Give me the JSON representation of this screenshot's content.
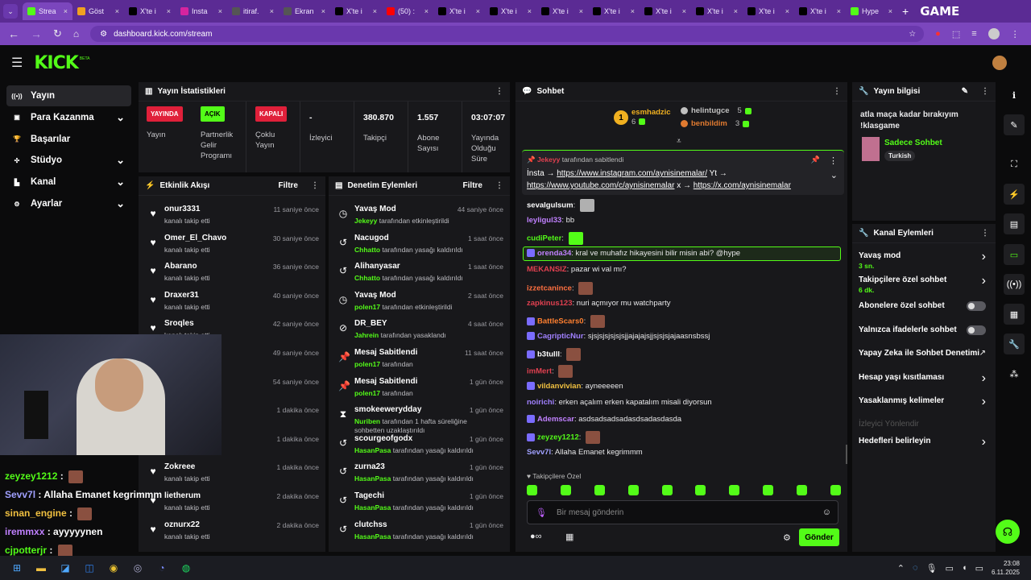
{
  "browser": {
    "tabs": [
      {
        "label": "Strea",
        "color": "#53fc18",
        "active": true
      },
      {
        "label": "Göst",
        "color": "#f0a020"
      },
      {
        "label": "X'te i",
        "color": "#000000"
      },
      {
        "label": "Insta",
        "color": "#d6249f"
      },
      {
        "label": "itiraf.",
        "color": "#555555"
      },
      {
        "label": "Ekran",
        "color": "#555555"
      },
      {
        "label": "X'te i",
        "color": "#000000"
      },
      {
        "label": "(50) :",
        "color": "#ff0000"
      },
      {
        "label": "X'te i",
        "color": "#000000"
      },
      {
        "label": "X'te i",
        "color": "#000000"
      },
      {
        "label": "X'te i",
        "color": "#000000"
      },
      {
        "label": "X'te i",
        "color": "#000000"
      },
      {
        "label": "X'te i",
        "color": "#000000"
      },
      {
        "label": "X'te i",
        "color": "#000000"
      },
      {
        "label": "X'te i",
        "color": "#000000"
      },
      {
        "label": "X'te i",
        "color": "#000000"
      },
      {
        "label": "Hype",
        "color": "#53fc18"
      }
    ],
    "url": "dashboard.kick.com/stream",
    "watermark": "GAME"
  },
  "kick": {
    "logo": "KICK",
    "beta": "BETA"
  },
  "sidebar": {
    "items": [
      {
        "label": "Yayın",
        "icon": "stream-icon",
        "active": true
      },
      {
        "label": "Para Kazanma",
        "icon": "money-icon",
        "chevron": true
      },
      {
        "label": "Başarılar",
        "icon": "trophy-icon"
      },
      {
        "label": "Stüdyo",
        "icon": "studio-icon",
        "chevron": true
      },
      {
        "label": "Kanal",
        "icon": "channel-icon",
        "chevron": true
      },
      {
        "label": "Ayarlar",
        "icon": "gear-icon",
        "chevron": true
      }
    ]
  },
  "stats": {
    "title": "Yayın İstatistikleri",
    "live_badge": "YAYINDA",
    "live_label": "Yayın",
    "partner_badge": "AÇIK",
    "partner_label": "Partnerlik Gelir Programı",
    "multi_badge": "KAPALI",
    "multi_label": "Çoklu Yayın",
    "viewers_val": "-",
    "viewers_label": "İzleyici",
    "followers_val": "380.870",
    "followers_label": "Takipçi",
    "subs_val": "1.557",
    "subs_label": "Abone Sayısı",
    "uptime_val": "03:07:07",
    "uptime_label": "Yayında Olduğu Süre"
  },
  "activity": {
    "title": "Etkinlik Akışı",
    "filter": "Filtre",
    "items": [
      {
        "name": "onur3331",
        "desc": "kanalı takip etti",
        "time": "11 saniye önce"
      },
      {
        "name": "Omer_El_Chavo",
        "desc": "kanalı takip etti",
        "time": "30 saniye önce"
      },
      {
        "name": "Abarano",
        "desc": "kanalı takip etti",
        "time": "36 saniye önce"
      },
      {
        "name": "Draxer31",
        "desc": "kanalı takip etti",
        "time": "40 saniye önce"
      },
      {
        "name": "Sroqles",
        "desc": "kanalı takip etti",
        "time": "42 saniye önce"
      },
      {
        "name": "",
        "desc": "",
        "time": "49 saniye önce"
      },
      {
        "name": "",
        "desc": "",
        "time": "54 saniye önce"
      },
      {
        "name": "",
        "desc": "",
        "time": "1 dakika önce"
      },
      {
        "name": "",
        "desc": "",
        "time": "1 dakika önce"
      },
      {
        "name": "Zokreee",
        "desc": "kanalı takip etti",
        "time": "1 dakika önce"
      },
      {
        "name": "lietherum",
        "desc": "kanalı takip etti",
        "time": "2 dakika önce"
      },
      {
        "name": "oznurx22",
        "desc": "kanalı takip etti",
        "time": "2 dakika önce"
      }
    ]
  },
  "moderation": {
    "title": "Denetim Eylemleri",
    "filter": "Filtre",
    "items": [
      {
        "action": "Yavaş Mod",
        "user": "Jekeyy",
        "desc": "tarafından etkinleştirildi",
        "time": "44 saniye önce",
        "icon": "slow-icon"
      },
      {
        "action": "Nacugod",
        "user": "Chhatto",
        "desc": "tarafından yasağı kaldırıldı",
        "time": "1 saat önce",
        "icon": "unban-icon"
      },
      {
        "action": "Alihanyasar",
        "user": "Chhatto",
        "desc": "tarafından yasağı kaldırıldı",
        "time": "1 saat önce",
        "icon": "unban-icon"
      },
      {
        "action": "Yavaş Mod",
        "user": "polen17",
        "desc": "tarafından etkinleştirildi",
        "time": "2 saat önce",
        "icon": "slow-icon"
      },
      {
        "action": "DR_BEY",
        "user": "Jahrein",
        "desc": "tarafından yasaklandı",
        "time": "4 saat önce",
        "icon": "ban-icon"
      },
      {
        "action": "Mesaj Sabitlendi",
        "user": "polen17",
        "desc": "tarafından",
        "time": "11 saat önce",
        "icon": "pin-icon"
      },
      {
        "action": "Mesaj Sabitlendi",
        "user": "polen17",
        "desc": "tarafından",
        "time": "1 gün önce",
        "icon": "pin-icon"
      },
      {
        "action": "smokeewerydday",
        "user": "Nuriben",
        "desc": "tarafından 1 hafta süreliğine sohbetten uzaklaştırıldı",
        "time": "1 gün önce",
        "icon": "timeout-icon"
      },
      {
        "action": "scourgeofgodx",
        "user": "HasanPasa",
        "desc": "tarafından yasağı kaldırıldı",
        "time": "1 gün önce",
        "icon": "unban-icon"
      },
      {
        "action": "zurna23",
        "user": "HasanPasa",
        "desc": "tarafından yasağı kaldırıldı",
        "time": "1 gün önce",
        "icon": "unban-icon"
      },
      {
        "action": "Tagechi",
        "user": "HasanPasa",
        "desc": "tarafından yasağı kaldırıldı",
        "time": "1 gün önce",
        "icon": "unban-icon"
      },
      {
        "action": "clutchss",
        "user": "HasanPasa",
        "desc": "tarafından yasağı kaldırıldı",
        "time": "1 gün önce",
        "icon": "unban-icon"
      }
    ]
  },
  "chat": {
    "title": "Sohbet",
    "leaders": [
      {
        "name": "esmhadzic",
        "count": "6",
        "rank": "1",
        "color": "#f0b020"
      },
      {
        "name": "helintugce",
        "count": "5",
        "color": "#c0c0c0"
      },
      {
        "name": "benbildim",
        "count": "3",
        "color": "#e07a30"
      }
    ],
    "pinned": {
      "by": "Jekeyy",
      "by_suffix": "tarafından sabitlendi",
      "line1_pre": "İnsta →",
      "link1": "https://www.instagram.com/aynisinemalar/",
      "line1_post": "Yt →",
      "link2": "https://www.youtube.com/c/aynisinemalar",
      "line2_mid": "x →",
      "link3": "https://x.com/aynisinemalar"
    },
    "messages": [
      {
        "user": "sevalgulsum",
        "color": "#ffffff",
        "text": "",
        "emote": true,
        "emote_color": "#b0b0b0"
      },
      {
        "user": "leyligul33",
        "color": "#c080ff",
        "text": "bb"
      },
      {
        "user": "cudiPeter",
        "color": "#53fc18",
        "text": "",
        "emote": true,
        "emote_color": "#53fc18"
      },
      {
        "user": "orenda34",
        "color": "#c080ff",
        "text": "kral ve muhafız hikayesini bilir misin abi? @hype",
        "highlight": true
      },
      {
        "user": "MEKANSIZ",
        "color": "#e04050",
        "text": "pazar wi val mı?"
      },
      {
        "user": "izzetcanince",
        "color": "#ff7040",
        "text": "",
        "emote": true
      },
      {
        "user": "zapkinus123",
        "color": "#e04050",
        "text": "nuri açmıyor mu watchparty"
      },
      {
        "user": "BattleScars0",
        "color": "#ff8030",
        "text": "",
        "emote": true
      },
      {
        "user": "CagripticNur",
        "color": "#a080ff",
        "text": "sjsjsjsjsjsjsjjajajajsjjsjsjsjajaasnsbssj"
      },
      {
        "user": "b3tulll",
        "color": "#ffffff",
        "text": "",
        "emote": true
      },
      {
        "user": "imMert",
        "color": "#e04050",
        "text": "",
        "emote": true
      },
      {
        "user": "vildanvivian",
        "color": "#f0c040",
        "text": "ayneeeeen"
      },
      {
        "user": "noirichi",
        "color": "#a080ff",
        "text": "erken açalım erken kapatalım misali diyorsun"
      },
      {
        "user": "Ademscar",
        "color": "#c080ff",
        "text": "asdsadsadsadasdsadasdasda"
      },
      {
        "user": "zeyzey1212",
        "color": "#53fc18",
        "text": "",
        "emote": true
      },
      {
        "user": "Sevv7l",
        "color": "#a0a0ff",
        "text": "Allaha Emanet kegrimmm"
      }
    ],
    "followers_only": "Takipçilere Özel",
    "placeholder": "Bir mesaj gönderin",
    "send": "Gönder"
  },
  "stream_info": {
    "title": "Yayın bilgisi",
    "stream_title": "atla maça kadar bırakıyım !klasgame",
    "category": "Sadece Sohbet",
    "language": "Turkish"
  },
  "channel_actions": {
    "title": "Kanal Eylemleri",
    "items": [
      {
        "label": "Yavaş mod",
        "sub": "3 sn.",
        "type": "chevron"
      },
      {
        "label": "Takipçilere özel sohbet",
        "sub": "6 dk.",
        "type": "chevron"
      },
      {
        "label": "Abonelere özel sohbet",
        "type": "toggle"
      },
      {
        "label": "Yalnızca ifadelerle sohbet",
        "type": "toggle"
      },
      {
        "label": "Yapay Zeka ile Sohbet Denetimi",
        "type": "external"
      },
      {
        "label": "Hesap yaşı kısıtlaması",
        "type": "chevron"
      },
      {
        "label": "Yasaklanmış kelimeler",
        "type": "chevron"
      },
      {
        "label": "İzleyici Yönlendir",
        "type": "disabled"
      },
      {
        "label": "Hedefleri belirleyin",
        "type": "chevron"
      }
    ]
  },
  "overlay_chat": [
    {
      "user": "zeyzey1212",
      "color": "#53fc18",
      "text": "",
      "emote": true
    },
    {
      "user": "Sevv7l",
      "color": "#a0a0ff",
      "text": "Allaha Emanet kegrimmm"
    },
    {
      "user": "sinan_engine",
      "color": "#f0c040",
      "text": "",
      "emote": true
    },
    {
      "user": "iremmxx",
      "color": "#c080ff",
      "text": "ayyyyynen"
    },
    {
      "user": "cjpotterjr",
      "color": "#53fc18",
      "text": "",
      "emote": true
    }
  ],
  "taskbar": {
    "time": "23:08",
    "date": "6.11.2025"
  }
}
